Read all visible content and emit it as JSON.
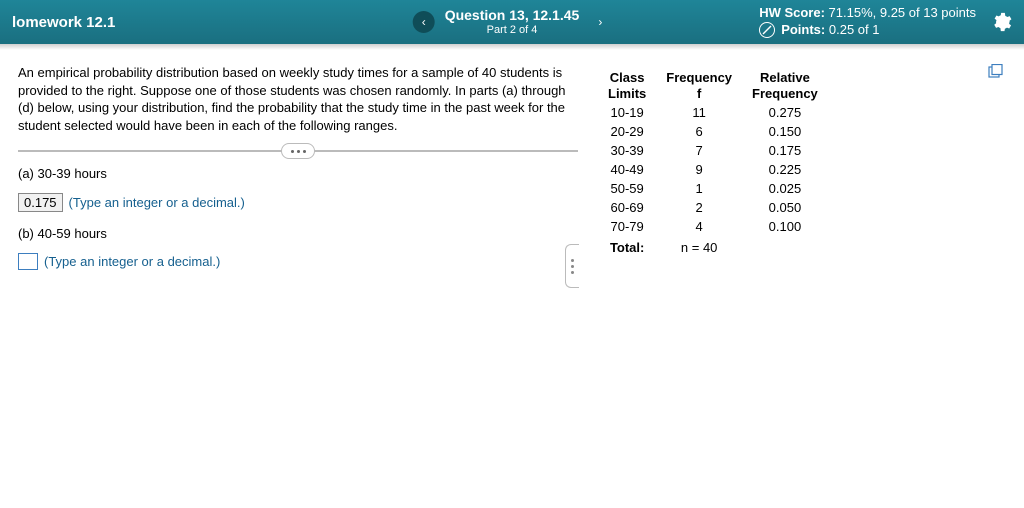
{
  "header": {
    "homework_title": "lomework 12.1",
    "question_main": "Question 13, 12.1.45",
    "question_sub": "Part 2 of 4",
    "hw_score_label": "HW Score:",
    "hw_score_value": "71.15%, 9.25 of 13 points",
    "points_label": "Points:",
    "points_value": "0.25 of 1"
  },
  "problem": {
    "text": "An empirical probability distribution based on weekly study times for a sample of 40 students is provided to the right. Suppose one of those students was chosen randomly. In parts (a) through (d) below, using your distribution, find the probability that the study time in the past week for the student selected would have been in each of the following ranges."
  },
  "parts": {
    "a_label": "(a) 30-39 hours",
    "a_answer": "0.175",
    "a_hint": "(Type an integer or a decimal.)",
    "b_label": "(b) 40-59 hours",
    "b_hint": "(Type an integer or a decimal.)"
  },
  "table": {
    "headers": {
      "c1a": "Class",
      "c1b": "Limits",
      "c2a": "Frequency",
      "c2b": "f",
      "c3a": "Relative",
      "c3b": "Frequency"
    },
    "rows": [
      {
        "limits": "10-19",
        "f": "11",
        "rf": "0.275"
      },
      {
        "limits": "20-29",
        "f": "6",
        "rf": "0.150"
      },
      {
        "limits": "30-39",
        "f": "7",
        "rf": "0.175"
      },
      {
        "limits": "40-49",
        "f": "9",
        "rf": "0.225"
      },
      {
        "limits": "50-59",
        "f": "1",
        "rf": "0.025"
      },
      {
        "limits": "60-69",
        "f": "2",
        "rf": "0.050"
      },
      {
        "limits": "70-79",
        "f": "4",
        "rf": "0.100"
      }
    ],
    "total_label": "Total:",
    "total_f": "n = 40"
  }
}
